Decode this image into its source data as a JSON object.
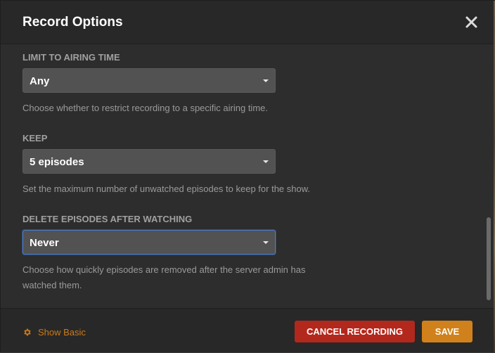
{
  "header": {
    "title": "Record Options",
    "close_icon": "close-icon"
  },
  "fields": [
    {
      "label": "LIMIT TO AIRING TIME",
      "value": "Any",
      "help": "Choose whether to restrict recording to a specific airing time."
    },
    {
      "label": "KEEP",
      "value": "5 episodes",
      "help": "Set the maximum number of unwatched episodes to keep for the show."
    },
    {
      "label": "DELETE EPISODES AFTER WATCHING",
      "value": "Never",
      "help": "Choose how quickly episodes are removed after the server admin has watched them."
    }
  ],
  "footer": {
    "show_basic_label": "Show Basic",
    "show_basic_icon": "gear-icon",
    "cancel_label": "CANCEL RECORDING",
    "save_label": "SAVE"
  },
  "colors": {
    "accent": "#cc7b19",
    "danger": "#b3281d",
    "save": "#d0811b",
    "focus": "#4b7bc9"
  }
}
